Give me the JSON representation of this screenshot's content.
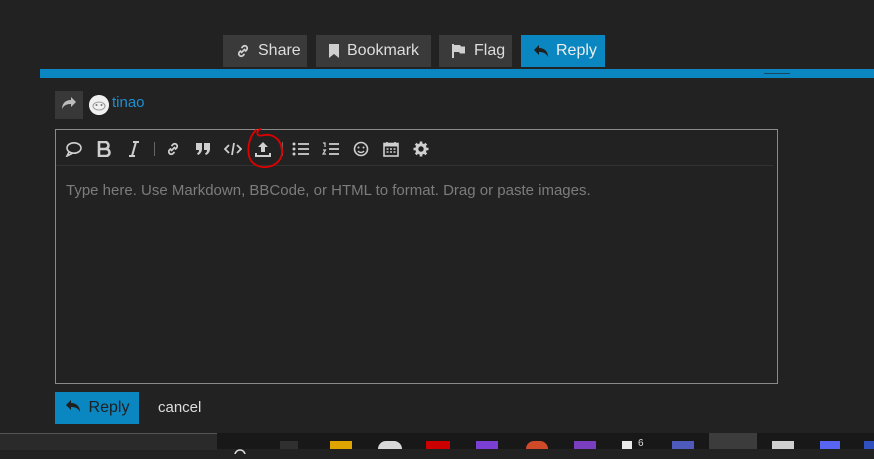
{
  "topbar": {
    "share_label": "Share",
    "bookmark_label": "Bookmark",
    "flag_label": "Flag",
    "reply_label": "Reply"
  },
  "composer": {
    "username": "tinao",
    "placeholder": "Type here. Use Markdown, BBCode, or HTML to format. Drag or paste images.",
    "toolbar_icons": [
      "quote-bubble-icon",
      "bold-icon",
      "italic-icon",
      "link-icon",
      "blockquote-icon",
      "code-icon",
      "upload-icon",
      "bullet-list-icon",
      "numbered-list-icon",
      "emoji-icon",
      "calendar-icon",
      "gear-icon"
    ],
    "reply_label": "Reply",
    "cancel_label": "cancel"
  },
  "taskbar": {
    "badge_count": "6"
  },
  "colors": {
    "accent": "#0a86c0",
    "annotation": "#e00000"
  }
}
